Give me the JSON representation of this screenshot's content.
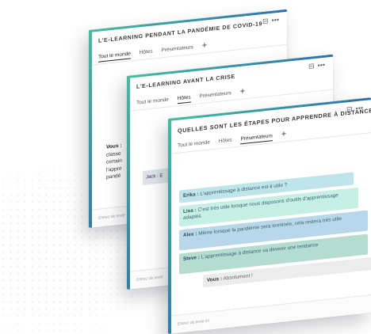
{
  "cards": [
    {
      "title": "L'E-LEARNING PENDANT LA PANDÉMIE DE COVID-19",
      "tabs": [
        "Tout le monde",
        "Hôtes",
        "Présentateurs"
      ],
      "active_tab": "Tout le monde",
      "add_tab": "+",
      "input_placeholder": "Entrez du texte",
      "peek_name": "Vous :",
      "peek_lines": [
        "classe",
        "certain",
        "l'appre",
        "pandé"
      ]
    },
    {
      "title": "L'E-LEARNING AVANT LA CRISE",
      "tabs": [
        "Tout le monde",
        "Hôtes",
        "Présentateurs"
      ],
      "active_tab": "Hôtes",
      "add_tab": "+",
      "input_placeholder": "Entrez du texte",
      "peek_message": "Jack : E"
    },
    {
      "title": "QUELLES SONT LES ÉTAPES POUR APPRENDRE À DISTANCE",
      "tabs": [
        "Tout le monde",
        "Hôtes",
        "Présentateurs"
      ],
      "active_tab": "Présentateurs",
      "add_tab": "+",
      "input_placeholder": "Entrez du texte ici",
      "messages": [
        {
          "name": "Erika :",
          "text": "L'apprentissage à distance est-il utile ?"
        },
        {
          "name": "Lisa :",
          "text": "C'est très utile lorsque nous disposons d'outils d'apprentissage adaptés"
        },
        {
          "name": "Alex :",
          "text": "Même lorsque la pandémie sera terminée, cela restera très utile"
        },
        {
          "name": "Steve :",
          "text": "L'apprentissage à distance va devenir une tendance"
        },
        {
          "name": "Vous :",
          "text": "Absolument !"
        }
      ]
    }
  ],
  "icons": {
    "minimize": "minimize-icon",
    "more": "more-icon"
  }
}
